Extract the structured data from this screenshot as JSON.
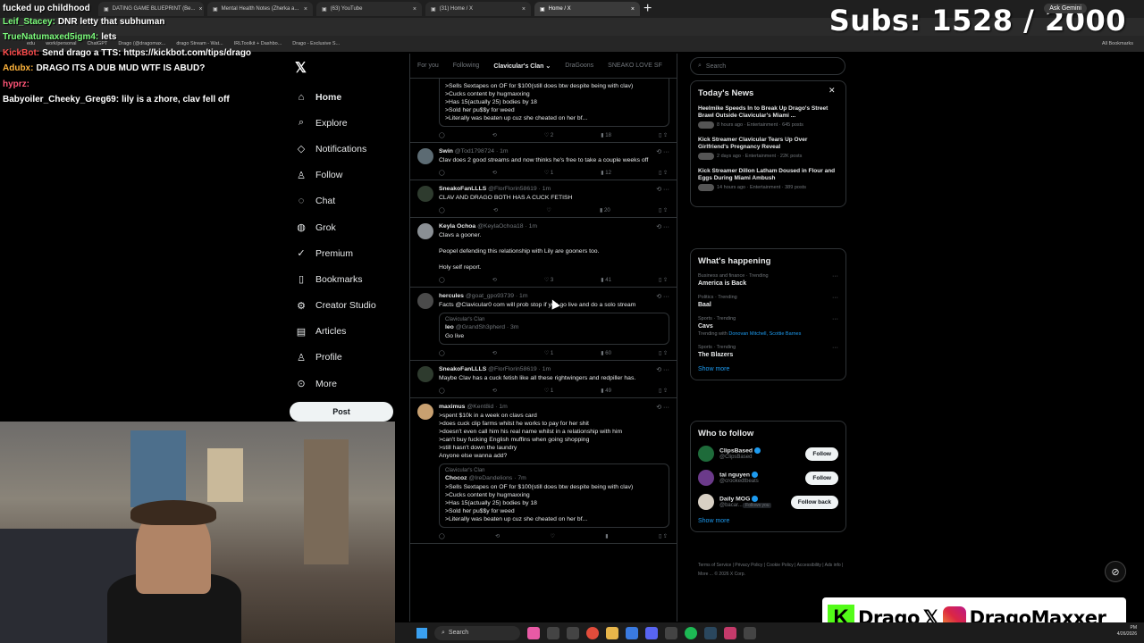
{
  "overlay": {
    "subs": "Subs: 1528 / 2000",
    "ask_gemini": "Ask Gemini",
    "chat_top": "fucked up childhood",
    "chat": [
      {
        "user": "Leif_Stacey:",
        "msg": "DNR letty that subhuman",
        "ucolor": "#7cfc7c"
      },
      {
        "user": "TrueNatumaxed5igm4:",
        "msg": "lets",
        "ucolor": "#7cfc7c"
      },
      {
        "user": "KickBot:",
        "msg": "Send drago a TTS: https://kickbot.com/tips/drago",
        "ucolor": "#ff4d4d"
      },
      {
        "user": "Adubx:",
        "msg": "DRAGO ITS A DUB MUD WTF IS ABUD?",
        "ucolor": "#ffb43c"
      },
      {
        "user": "hyprz:",
        "msg": "",
        "ucolor": "#ff5577"
      },
      {
        "user": "Babyoiler_Cheeky_Greg69:",
        "msg": "lily is a zhore, clav fell off",
        "ucolor": "#ffffff"
      }
    ],
    "brand": {
      "kick": "Drago",
      "ig": "DragoMaxxer"
    }
  },
  "browser": {
    "tabs": [
      {
        "label": "DATING GAME BLUEPRINT (Be..."
      },
      {
        "label": "Mental Health Notes (Zherka a..."
      },
      {
        "label": "(63) YouTube"
      },
      {
        "label": "(31) Home / X"
      },
      {
        "label": "Home / X",
        "active": true
      }
    ],
    "bookmarks": [
      "edu",
      "work/personal",
      "ChatGPT",
      "Drago (@dragomax...",
      "drago Stream - Wat...",
      "IRLToolkit + Dashbo...",
      "Drago - Exclusive S..."
    ],
    "all_bookmarks": "All Bookmarks"
  },
  "nav": {
    "items": [
      {
        "label": "Home",
        "icon": "⌂",
        "bold": true
      },
      {
        "label": "Explore",
        "icon": "⌕"
      },
      {
        "label": "Notifications",
        "icon": "◇"
      },
      {
        "label": "Follow",
        "icon": "♙"
      },
      {
        "label": "Chat",
        "icon": "◌"
      },
      {
        "label": "Grok",
        "icon": "◍"
      },
      {
        "label": "Premium",
        "icon": "✓"
      },
      {
        "label": "Bookmarks",
        "icon": "▯"
      },
      {
        "label": "Creator Studio",
        "icon": "⚙"
      },
      {
        "label": "Articles",
        "icon": "▤"
      },
      {
        "label": "Profile",
        "icon": "♙"
      },
      {
        "label": "More",
        "icon": "⊙"
      }
    ],
    "post_label": "Post"
  },
  "timeline": {
    "tabs": [
      "For you",
      "Following",
      "Clavicular's Clan",
      "DraGoons",
      "SNEAKO LOVE SF"
    ],
    "posts": [
      {
        "name": "",
        "handle": "",
        "time": "",
        "color": "#000",
        "text": ">Sells Sextapes on OF for $100(still does btw despite being with clav)\n>Cucks content by hugmaxxing\n>Has 15(actually 25) bodies by 18\n>Sold her pu$$y for weed\n>Literally was beaten up cuz she cheated on her bf...",
        "quote_style": true,
        "acts": {
          "reply": "",
          "rt": "",
          "like": "2",
          "views": "18"
        }
      },
      {
        "name": "Swin",
        "handle": "@Tod1798724 · 1m",
        "color": "#5c6b73",
        "text": "Clav does 2 good streams and now thinks he's free to take a couple weeks off",
        "acts": {
          "reply": "",
          "rt": "",
          "like": "1",
          "views": "12"
        }
      },
      {
        "name": "SneakoFanLLLS",
        "handle": "@FlorFlorin58619 · 1m",
        "color": "#2e3b2e",
        "text": "CLAV AND DRAGO BOTH HAS A CUCK FETISH",
        "acts": {
          "reply": "",
          "rt": "",
          "like": "",
          "views": "20"
        }
      },
      {
        "name": "Keyla Ochoa",
        "handle": "@KeylaOchoa18 · 1m",
        "color": "#8a8f94",
        "text": "Clavs a gooner.\n\nPeopel defending this relationship with Lily are gooners too.\n\nHoly self report.",
        "acts": {
          "reply": "",
          "rt": "",
          "like": "3",
          "views": "41"
        }
      },
      {
        "name": "hercules",
        "handle": "@goat_gpo93739 · 1m",
        "color": "#4a4a4a",
        "text": "Facts @Clavicular0 com will prob stop if you go live and do a solo stream",
        "quote": {
          "clan": "Clavicular's Clan",
          "qname": "leo",
          "qhandle": "@GrandSh3pherd · 3m",
          "qtext": "Go live"
        },
        "acts": {
          "reply": "",
          "rt": "",
          "like": "1",
          "views": "60"
        }
      },
      {
        "name": "SneakoFanLLLS",
        "handle": "@FlorFlorin58619 · 1m",
        "color": "#2e3b2e",
        "text": "Maybe Clav has a cuck fetish like all these rightwingers and redpiller has.",
        "acts": {
          "reply": "",
          "rt": "",
          "like": "1",
          "views": "49"
        }
      },
      {
        "name": "maximus",
        "handle": "@Kent8id · 1m",
        "color": "#c8a070",
        "text": ">spent $10k in a week on clavs card\n>does cuck clip farms whilst he works to pay for her shit\n>doesn't even call him his real name whilst in a relationship with him\n>can't buy fucking English muffins when going shopping\n>still hasn't down the laundry\nAnyone else wanna add?",
        "quote": {
          "clan": "Clavicular's Clan",
          "qname": "Chocoz",
          "qhandle": "@IreDandelions · 7m",
          "qtext": ">Sells Sextapes on OF for $100(still does btw despite being with clav)\n>Cucks content by hugmaxxing\n>Has 15(actually 25) bodies by 18\n>Sold her pu$$y for weed\n>Literally was beaten up cuz she cheated on her bf..."
        },
        "acts": {
          "reply": "",
          "rt": "",
          "like": "",
          "views": ""
        }
      }
    ]
  },
  "sidebar": {
    "search_placeholder": "Search",
    "news_title": "Today's News",
    "news": [
      {
        "title": "Heelmike Speeds In to Break Up Drago's Street Brawl Outside Clavicular's Miami ...",
        "meta": "8 hours ago · Entertainment · 645 posts"
      },
      {
        "title": "Kick Streamer Clavicular Tears Up Over Girlfriend's Pregnancy Reveal",
        "meta": "2 days ago · Entertainment · 22K posts"
      },
      {
        "title": "Kick Streamer Dillon Latham Doused in Flour and Eggs During Miami Ambush",
        "meta": "14 hours ago · Entertainment · 389 posts"
      }
    ],
    "happening_title": "What's happening",
    "trends": [
      {
        "cat": "Business and finance · Trending",
        "name": "America is Back",
        "with": ""
      },
      {
        "cat": "Politics · Trending",
        "name": "Baal",
        "with": ""
      },
      {
        "cat": "Sports · Trending",
        "name": "Cavs",
        "with_prefix": "Trending with",
        "with": "Donovan Mitchell, Scottie Barnes"
      },
      {
        "cat": "Sports · Trending",
        "name": "The Blazers",
        "with": ""
      }
    ],
    "show_more": "Show more",
    "wtf_title": "Who to follow",
    "follow": [
      {
        "name": "ClipsBased",
        "handle": "@ClipsBased",
        "btn": "Follow",
        "color": "#1e6b3a"
      },
      {
        "name": "tai nguyen",
        "handle": "@crookedtbeats",
        "btn": "Follow",
        "color": "#6b3a8a"
      },
      {
        "name": "Daily MOG",
        "handle": "@bacar...",
        "btn": "Follow back",
        "note": "Follows you",
        "color": "#d8d0c4"
      }
    ],
    "footer": "Terms of Service | Privacy Policy | Cookie Policy | Accessibility | Ads info | More ... © 2026 X Corp."
  },
  "taskbar": {
    "search": "Search",
    "clock_time": "PM",
    "clock_date": "4/26/2026"
  }
}
